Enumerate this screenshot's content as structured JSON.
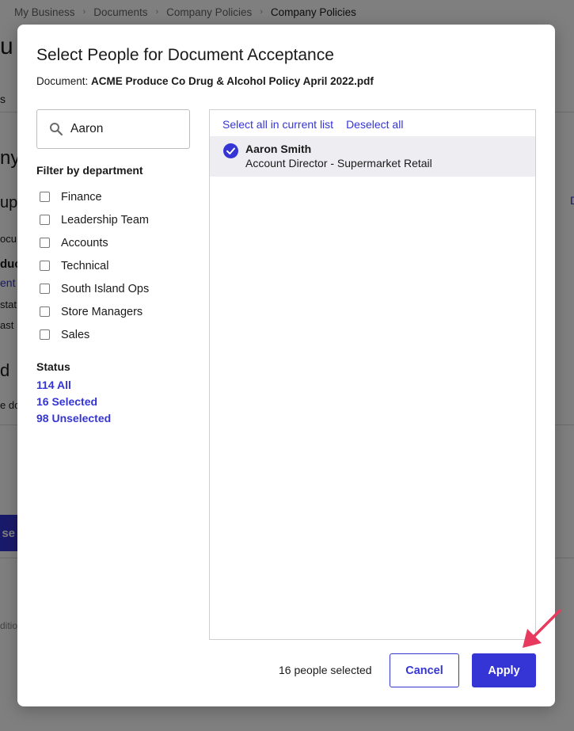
{
  "background": {
    "breadcrumb": [
      "My Business",
      "Documents",
      "Company Policies",
      "Company Policies"
    ],
    "fragments": {
      "title": "u",
      "tab": "s",
      "heading1": "ny",
      "heading2": "up",
      "line1": "ocu",
      "line2": "duc",
      "link": "ent",
      "line3": "stat",
      "line4": "ast",
      "heading3": "d",
      "line5": "e do",
      "footer": "ditio"
    },
    "button_label": "se"
  },
  "modal": {
    "title": "Select People for Document Acceptance",
    "document_label": "Document:",
    "document_name": "ACME Produce Co Drug & Alcohol Policy April 2022.pdf",
    "search": {
      "value": "Aaron",
      "icon": "search-icon"
    },
    "filter_heading": "Filter by department",
    "departments": [
      {
        "label": "Finance",
        "checked": false
      },
      {
        "label": "Leadership Team",
        "checked": false
      },
      {
        "label": "Accounts",
        "checked": false
      },
      {
        "label": "Technical",
        "checked": false
      },
      {
        "label": "South Island Ops",
        "checked": false
      },
      {
        "label": "Store Managers",
        "checked": false
      },
      {
        "label": "Sales",
        "checked": false
      }
    ],
    "status_heading": "Status",
    "status_links": [
      "114 All",
      "16 Selected",
      "98 Unselected"
    ],
    "select_all_label": "Select all in current list",
    "deselect_all_label": "Deselect all",
    "people": [
      {
        "name": "Aaron Smith",
        "role": "Account Director - Supermarket Retail",
        "selected": true
      }
    ],
    "selected_count": "16 people selected",
    "cancel_label": "Cancel",
    "apply_label": "Apply"
  },
  "colors": {
    "accent": "#3535d6",
    "row_highlight": "#eeeef2",
    "annotation_arrow": "#e8395e",
    "overlay": "rgba(0,0,0,0.5)"
  }
}
